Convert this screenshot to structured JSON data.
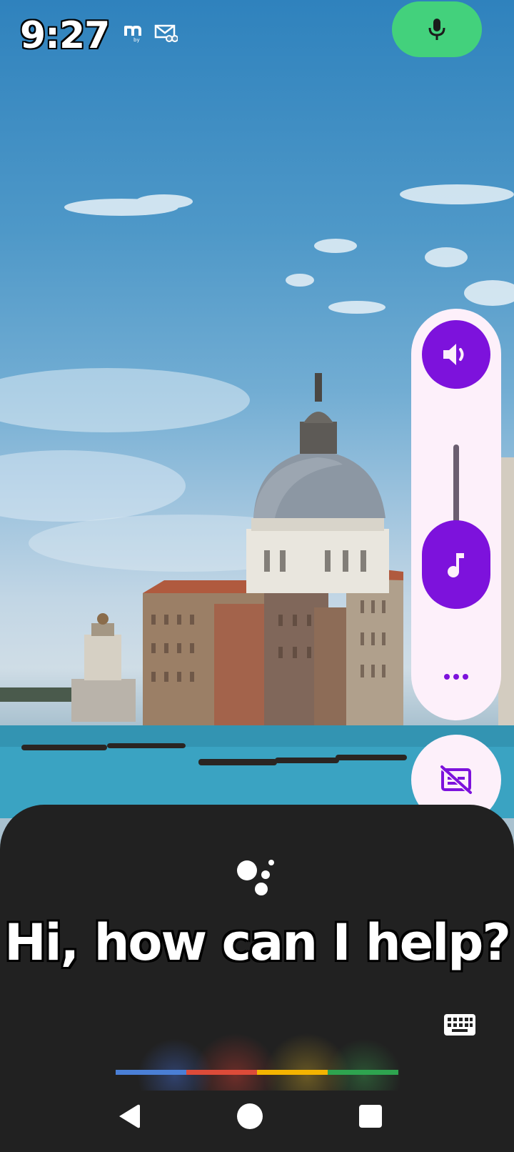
{
  "status_bar": {
    "time": "9:27",
    "notification_icons": [
      "m-app-icon",
      "mail-icon"
    ],
    "mic_indicator_icon": "mic-icon",
    "mic_indicator_color": "#43d17c"
  },
  "volume_panel": {
    "speaker_button_icon": "volume-icon",
    "media_volume_level": 0.23,
    "slider_thumb_icon": "music-note-icon",
    "more_icon": "more-dots-icon",
    "live_caption_icon": "caption-off-icon",
    "accent_color": "#7d12dc",
    "panel_color": "#fdf0fa"
  },
  "assistant": {
    "prompt": "Hi, how can I help?",
    "logo_icon": "google-assistant-icon",
    "keyboard_icon": "keyboard-icon",
    "sheet_color": "#212121",
    "voice_bar_colors": [
      "#4a7fd6",
      "#dd4b39",
      "#f4b400",
      "#2ea44f"
    ]
  },
  "nav_bar": {
    "back_icon": "back-triangle-icon",
    "home_icon": "home-circle-icon",
    "recents_icon": "recents-square-icon"
  }
}
